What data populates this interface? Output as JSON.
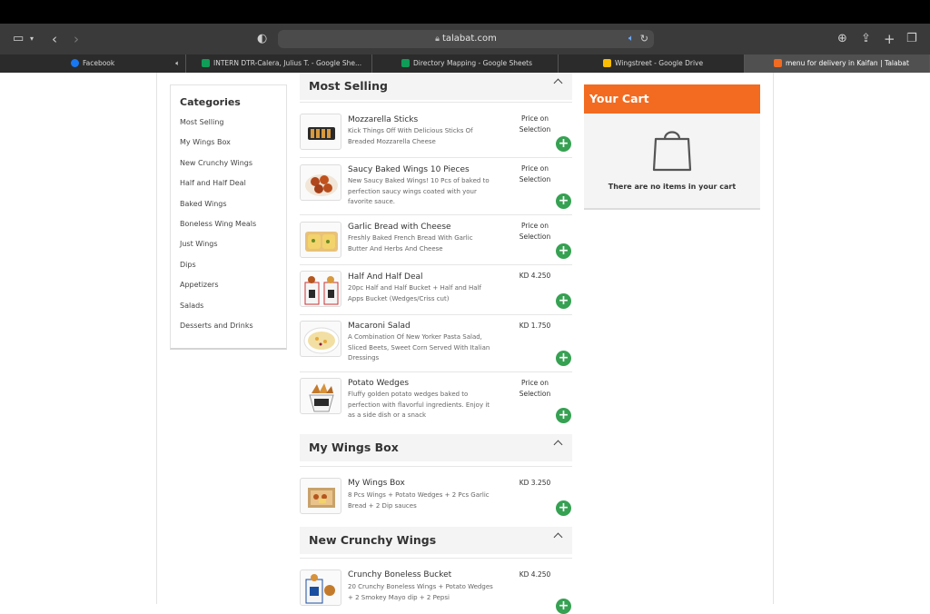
{
  "browser": {
    "url": "talabat.com",
    "tabs": [
      {
        "label": "Facebook",
        "favicon_color": "#1877f2"
      },
      {
        "label": "INTERN DTR-Calera, Julius T. - Google She...",
        "favicon_color": "#0f9d58"
      },
      {
        "label": "Directory Mapping - Google Sheets",
        "favicon_color": "#0f9d58"
      },
      {
        "label": "Wingstreet - Google Drive",
        "favicon_color": "#fbbc04"
      },
      {
        "label": "menu for delivery in Kaifan | Talabat",
        "favicon_color": "#f26b21"
      }
    ]
  },
  "categories": {
    "title": "Categories",
    "items": [
      "Most Selling",
      "My Wings Box",
      "New Crunchy Wings",
      "Half and Half Deal",
      "Baked Wings",
      "Boneless Wing Meals",
      "Just Wings",
      "Dips",
      "Appetizers",
      "Salads",
      "Desserts and Drinks"
    ]
  },
  "sections": [
    {
      "title": "Most Selling",
      "items": [
        {
          "name": "Mozzarella Sticks",
          "desc": "Kick Things Off With Delicious Sticks Of Breaded Mozzarella Cheese",
          "price": "Price on Selection"
        },
        {
          "name": "Saucy Baked Wings 10 Pieces",
          "desc": "New Saucy Baked Wings! 10 Pcs of baked to perfection saucy wings coated with your favorite sauce.",
          "price": "Price on Selection"
        },
        {
          "name": "Garlic Bread with Cheese",
          "desc": "Freshly Baked French Bread With Garlic Butter And Herbs And Cheese",
          "price": "Price on Selection"
        },
        {
          "name": "Half And Half Deal",
          "desc": "20pc Half and Half Bucket + Half and Half Apps Bucket (Wedges/Criss cut)",
          "price": "KD 4.250"
        },
        {
          "name": "Macaroni Salad",
          "desc": "A Combination Of New Yorker Pasta Salad, Sliced Beets, Sweet Corn Served With Italian Dressings",
          "price": "KD 1.750"
        },
        {
          "name": "Potato Wedges",
          "desc": "Fluffy golden potato wedges baked to perfection with flavorful ingredients. Enjoy it as a side dish or a snack",
          "price": "Price on Selection"
        }
      ]
    },
    {
      "title": "My Wings Box",
      "items": [
        {
          "name": "My Wings Box",
          "desc": "8 Pcs Wings + Potato Wedges + 2 Pcs Garlic Bread + 2 Dip sauces",
          "price": "KD 3.250"
        }
      ]
    },
    {
      "title": "New Crunchy Wings",
      "items": [
        {
          "name": "Crunchy Boneless Bucket",
          "desc": "20 Crunchy Boneless Wings + Potato Wedges + 2 Smokey Mayo dip + 2 Pepsi",
          "price": "KD 4.250"
        }
      ]
    }
  ],
  "cart": {
    "title": "Your Cart",
    "empty_message": "There are no items in your cart",
    "accent": "#f26b21"
  },
  "add_button_symbol": "+",
  "colors": {
    "add_button": "#36a152",
    "section_header_bg": "#f4f4f4"
  }
}
